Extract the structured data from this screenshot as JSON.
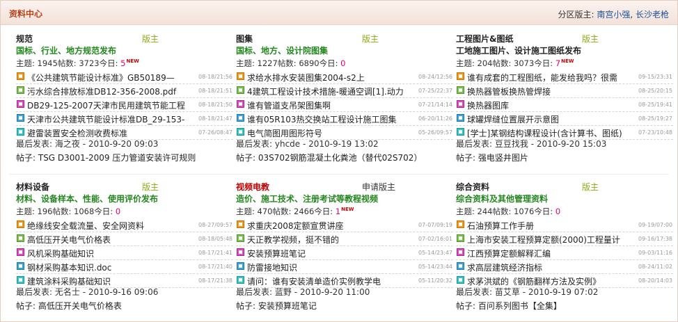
{
  "header": {
    "title": "资料中心",
    "moderators_label": "分区版主:",
    "moderators": [
      "南宫小强",
      "长沙老枪"
    ],
    "moderator_separator": ","
  },
  "forums": [
    {
      "name": "规范",
      "name_red": false,
      "moderator_label": "版主",
      "moderator_dark": false,
      "description": "国标、行业、地方规范发布",
      "desc_black": false,
      "topics_label": "主题: ",
      "topics": "1945",
      "posts_label": "帖数: ",
      "posts": "3723",
      "today_label": "今日: ",
      "today": "5",
      "today_new": "NEW",
      "threads": [
        {
          "icon": "orange",
          "title": "《公共建筑节能设计标准》GB50189—",
          "date": "08-18/21:56"
        },
        {
          "icon": "green",
          "title": "污水综合排放标准DB12-356-2008.pdf",
          "date": "08-18/21:51"
        },
        {
          "icon": "pink",
          "title": "DB29-125-2007天津市民用建筑节能工程",
          "date": "08-18/21:50"
        },
        {
          "icon": "blue",
          "title": "天津市公共建筑节能设计标准DB_29-153-",
          "date": "08-18/21:47"
        },
        {
          "icon": "cyan",
          "title": "避雷装置安全检测收费标准",
          "date": "07-26/08:47"
        }
      ],
      "last_label": "最后发表: ",
      "last_user": "海之夜",
      "last_time": "2010-9-20 09:03",
      "post_label": "帖子: ",
      "post_title": "TSG D3001-2009 压力管道安装许可规则"
    },
    {
      "name": "图集",
      "name_red": false,
      "moderator_label": "版主",
      "moderator_dark": false,
      "description": "国标、地方、设计院图集",
      "desc_black": false,
      "topics_label": "主题: ",
      "topics": "1227",
      "posts_label": "帖数: ",
      "posts": "6890",
      "today_label": "今日: ",
      "today": "0",
      "today_new": "",
      "threads": [
        {
          "icon": "orange",
          "title": "求给水排水安装图集2004-s2上",
          "date": "08-24/12:56"
        },
        {
          "icon": "green",
          "title": "4建筑工程设计技术措施-暖通空调[1].动力",
          "date": "07-25/22:37"
        },
        {
          "icon": "pink",
          "title": "谁有管道支吊架图集啊",
          "date": "07-21/14:14"
        },
        {
          "icon": "blue",
          "title": "谁有05R103热交换站工程设计施工图集",
          "date": "06-20/11:26"
        },
        {
          "icon": "cyan",
          "title": "电气简图用图形符号",
          "date": "05-26/09:57"
        }
      ],
      "last_label": "最后发表: ",
      "last_user": "yhcde",
      "last_time": "2010-9-19 13:02",
      "post_label": "帖子: ",
      "post_title": "03S702钢筋混凝土化粪池（替代02S702）"
    },
    {
      "name": "工程图片&图纸",
      "name_red": false,
      "moderator_label": "版主",
      "moderator_dark": false,
      "description": "工地施工图片、设计施工图纸发布",
      "desc_black": true,
      "topics_label": "主题: ",
      "topics": "204",
      "posts_label": "帖数: ",
      "posts": "3073",
      "today_label": "今日: ",
      "today": "7",
      "today_new": "NEW",
      "threads": [
        {
          "icon": "orange",
          "title": "谁有成套的工程图纸，能发给我吗？很需",
          "date": "09-15/23:31"
        },
        {
          "icon": "green",
          "title": "换热器管板换热管焊接",
          "date": "08-25/20:15"
        },
        {
          "icon": "pink",
          "title": "换热器图库",
          "date": "08-25/19:41"
        },
        {
          "icon": "blue",
          "title": "球罐焊缝位置展开示意图",
          "date": "08-25/19:27"
        },
        {
          "icon": "cyan",
          "title": "[学士]某钢结构课程设计(含计算书、图纸)",
          "date": "07-23/10:48"
        }
      ],
      "last_label": "最后发表: ",
      "last_user": "豆豆找我",
      "last_time": "2010-9-20 15:03",
      "post_label": "帖子: ",
      "post_title": "强电竖井图片"
    },
    {
      "name": "材料设备",
      "name_red": false,
      "moderator_label": "版主",
      "moderator_dark": false,
      "description": "材料、设备样本、性能、使用评价发布",
      "desc_black": false,
      "topics_label": "主题: ",
      "topics": "196",
      "posts_label": "帖数: ",
      "posts": "1068",
      "today_label": "今日: ",
      "today": "0",
      "today_new": "",
      "threads": [
        {
          "icon": "orange",
          "title": "绝缘线安全载流量、安全网资料",
          "date": "08-27/09:57"
        },
        {
          "icon": "green",
          "title": "高低压开关电气价格表",
          "date": "08-18/05:48"
        },
        {
          "icon": "pink",
          "title": "风机采购基础知识",
          "date": "08-17/21:41"
        },
        {
          "icon": "blue",
          "title": "钢材采购基本知识.doc",
          "date": "08-17/21:40"
        },
        {
          "icon": "cyan",
          "title": "建筑涂料采购基础知识",
          "date": "08-17/21:38"
        }
      ],
      "last_label": "最后发表: ",
      "last_user": "无名士",
      "last_time": "2010-9-16 09:06",
      "post_label": "帖子: ",
      "post_title": "高低压开关电气价格表"
    },
    {
      "name": "视频电教",
      "name_red": true,
      "moderator_label": "申请版主",
      "moderator_dark": true,
      "description": "造价、施工技术、注册考试等教程视频",
      "desc_black": false,
      "topics_label": "主题: ",
      "topics": "470",
      "posts_label": "帖数: ",
      "posts": "2466",
      "today_label": "今日: ",
      "today": "1",
      "today_new": "NEW",
      "threads": [
        {
          "icon": "orange",
          "title": "求重庆2008定额宣贯讲座",
          "date": "07-07/09:19"
        },
        {
          "icon": "green",
          "title": "天正教学视频，挺不错的",
          "date": "07-02/16:01"
        },
        {
          "icon": "pink",
          "title": "安装预算班笔记",
          "date": "05-14/23:47"
        },
        {
          "icon": "blue",
          "title": "防雷接地知识",
          "date": "05-14/23:44"
        },
        {
          "icon": "cyan",
          "title": "请问：谁有安装清单造价实例教学电",
          "date": "05-11/20:32"
        }
      ],
      "last_label": "最后发表: ",
      "last_user": "蓝野",
      "last_time": "2010-9-20 11:00",
      "post_label": "帖子: ",
      "post_title": "安装预算班笔记"
    },
    {
      "name": "综合资料",
      "name_red": false,
      "moderator_label": "版主",
      "moderator_dark": false,
      "description": "综合资料及其他管理资料",
      "desc_black": false,
      "topics_label": "主题: ",
      "topics": "244",
      "posts_label": "帖数: ",
      "posts": "1076",
      "today_label": "今日: ",
      "today": "0",
      "today_new": "",
      "threads": [
        {
          "icon": "orange",
          "title": "石油预算工作手册",
          "date": "09-19/07:00"
        },
        {
          "icon": "green",
          "title": "上海市安装工程预算定额(2000)工程量计",
          "date": "09-16/17:38"
        },
        {
          "icon": "pink",
          "title": "江西预算定额解释汇编",
          "date": "09-03/11:16"
        },
        {
          "icon": "blue",
          "title": "求高层建筑经济指标",
          "date": "08-24/11:02"
        },
        {
          "icon": "cyan",
          "title": "求茅洪斌的《钢筋翻样方法及实例》",
          "date": "08-20/14:03"
        }
      ],
      "last_label": "最后发表: ",
      "last_user": "苗艾草",
      "last_time": "2010-9-19 07:02",
      "post_label": "帖子: ",
      "post_title": "百问系列图书【全集】"
    }
  ]
}
